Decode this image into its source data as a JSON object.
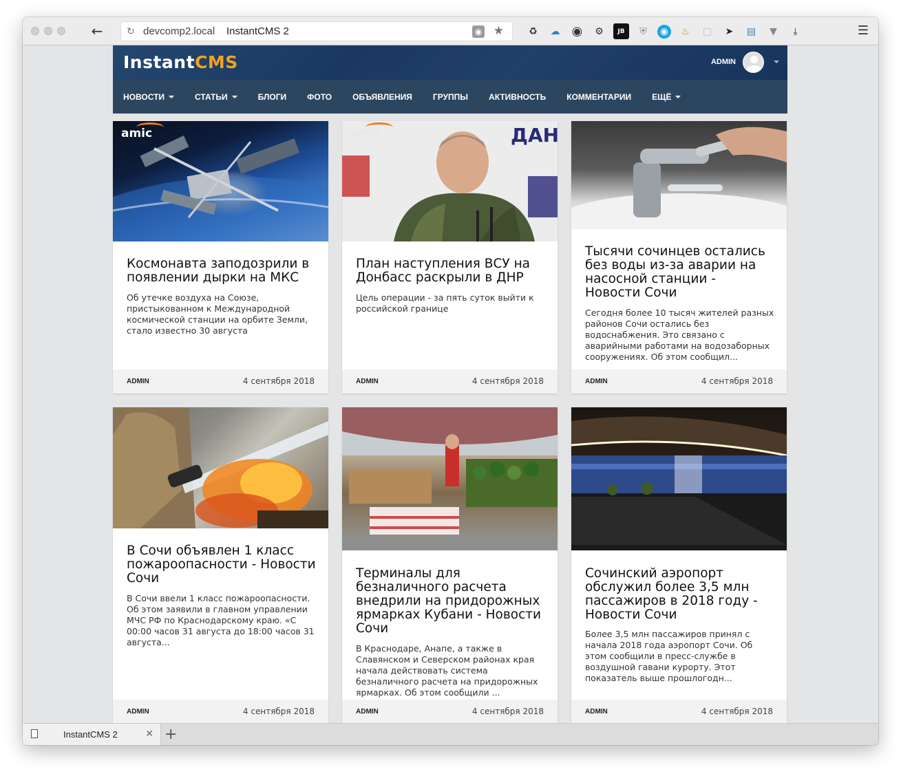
{
  "browser": {
    "url_host": "devcomp2.local",
    "page_title": "InstantCMS 2",
    "extensions": [
      "recycle-icon",
      "cloud-icon",
      "eye-icon",
      "gear-icon",
      "jetbrains-icon",
      "shield-icon",
      "eye-circle-icon",
      "fire-icon",
      "cube-icon",
      "bolt-icon",
      "folder-icon",
      "vuejs-icon",
      "download-icon"
    ],
    "tab_label": "InstantCMS 2"
  },
  "site": {
    "logo_part1": "Instant",
    "logo_part2": "CMS",
    "user_name": "ADMIN",
    "colors": {
      "header": "#1e3d66",
      "nav": "#2d4660",
      "logo_accent": "#f2a31b"
    }
  },
  "nav": [
    {
      "label": "НОВОСТИ",
      "dropdown": true
    },
    {
      "label": "СТАТЬИ",
      "dropdown": true
    },
    {
      "label": "БЛОГИ",
      "dropdown": false
    },
    {
      "label": "ФОТО",
      "dropdown": false
    },
    {
      "label": "ОБЪЯВЛЕНИЯ",
      "dropdown": false
    },
    {
      "label": "ГРУППЫ",
      "dropdown": false
    },
    {
      "label": "АКТИВНОСТЬ",
      "dropdown": false
    },
    {
      "label": "КОММЕНТАРИИ",
      "dropdown": false
    },
    {
      "label": "ЕЩЁ",
      "dropdown": true
    }
  ],
  "watermark": "amic",
  "cards": [
    {
      "title": "Космонавта заподозрили в появлении дырки на МКС",
      "desc": "Об утечке воздуха на Союзе, пристыкованном к Международной космической станции на орбите Земли, стало известно 30 августа",
      "author": "ADMIN",
      "date": "4 сентября 2018"
    },
    {
      "title": "План наступления ВСУ на Донбасс раскрыли в ДНР",
      "desc": "Цель операции - за пять суток выйти к российской границе",
      "author": "ADMIN",
      "date": "4 сентября 2018"
    },
    {
      "title": "Тысячи сочинцев остались без воды из-за аварии на насосной станции - Новости Сочи",
      "desc": "Сегодня более 10 тысяч жителей разных районов Сочи остались без водоснабжения. Это связано с аварийными работами на водозаборных сооружениях. Об этом сообщил...",
      "author": "ADMIN",
      "date": "4 сентября 2018"
    },
    {
      "title": "В Сочи объявлен 1 класс пожароопасности - Новости Сочи",
      "desc": "В Сочи ввели 1 класс пожароопасности. Об этом заявили в главном управлении МЧС РФ по Краснодарскому краю. «С 00:00 часов 31 августа до 18:00 часов 31 августа...",
      "author": "ADMIN",
      "date": "4 сентября 2018"
    },
    {
      "title": "Терминалы для безналичного расчета внедрили на придорожных ярмарках Кубани - Новости Сочи",
      "desc": "В Краснодаре, Анапе, а также в Славянском и Северском районах края начала действовать система безналичного расчета на придорожных ярмарках. Об этом сообщили ...",
      "author": "ADMIN",
      "date": "4 сентября 2018"
    },
    {
      "title": "Сочинский аэропорт обслужил более 3,5 млн пассажиров в 2018 году - Новости Сочи",
      "desc": "Более 3,5 млн пассажиров принял с начала 2018 года аэропорт Сочи. Об этом сообщили в пресс-службе в воздушной гавани курорту. Этот показатель выше прошлогодн...",
      "author": "ADMIN",
      "date": "4 сентября 2018"
    }
  ]
}
